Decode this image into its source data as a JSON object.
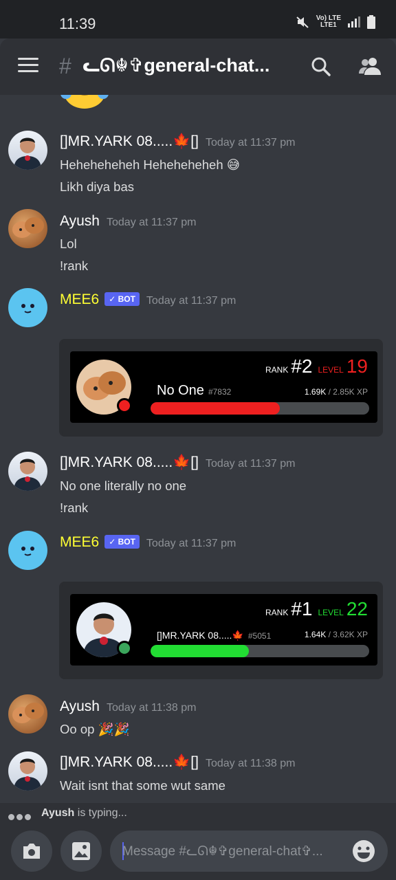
{
  "status_bar": {
    "time": "11:39",
    "network_top": "Vo) LTE",
    "network_bottom": "LTE1"
  },
  "header": {
    "hash": "#",
    "channel_name": "ᓚᘏ☬✞general-chat..."
  },
  "messages": [
    {
      "author": "[]MR.YARK 08.....🍁[]",
      "timestamp": "Today at 11:37 pm",
      "lines": [
        "Heheheheheh Heheheheheh 😅",
        "Likh diya bas"
      ]
    },
    {
      "author": "Ayush",
      "timestamp": "Today at 11:37 pm",
      "lines": [
        "Lol",
        "!rank"
      ]
    },
    {
      "author": "MEE6",
      "bot_badge": "BOT",
      "timestamp": "Today at 11:37 pm",
      "rank_card": {
        "rank_label": "RANK",
        "rank": "#2",
        "level_label": "LEVEL",
        "level": "19",
        "name": "No One",
        "discriminator": "#7832",
        "xp_current": "1.69K",
        "xp_total": "/ 2.85K XP",
        "progress": 0.59,
        "status": "dnd",
        "bar_color": "#ee2020",
        "level_color": "#ee2020"
      }
    },
    {
      "author": "[]MR.YARK 08.....🍁[]",
      "timestamp": "Today at 11:37 pm",
      "lines": [
        "No one literally no one",
        "!rank"
      ]
    },
    {
      "author": "MEE6",
      "bot_badge": "BOT",
      "timestamp": "Today at 11:37 pm",
      "rank_card": {
        "rank_label": "RANK",
        "rank": "#1",
        "level_label": "LEVEL",
        "level": "22",
        "name": "[]MR.YARK 08.....🍁",
        "discriminator": "#5051",
        "xp_current": "1.64K",
        "xp_total": "/ 3.62K XP",
        "progress": 0.45,
        "status": "online",
        "bar_color": "#22dd33",
        "level_color": "#22dd33"
      }
    },
    {
      "author": "Ayush",
      "timestamp": "Today at 11:38 pm",
      "lines": [
        "Oo op 🎉🎉"
      ]
    },
    {
      "author": "[]MR.YARK 08.....🍁[]",
      "timestamp": "Today at 11:38 pm",
      "lines": [
        "Wait isnt that some wut same"
      ]
    }
  ],
  "typing": {
    "user": "Ayush",
    "text": "is typing..."
  },
  "composer": {
    "placeholder": "Message #ᓚᘏ☬✞general-chat✞..."
  },
  "colors": {
    "background": "#36393f",
    "header": "#2f3136",
    "accent": "#5865f2",
    "bot_name": "#ffff33"
  }
}
